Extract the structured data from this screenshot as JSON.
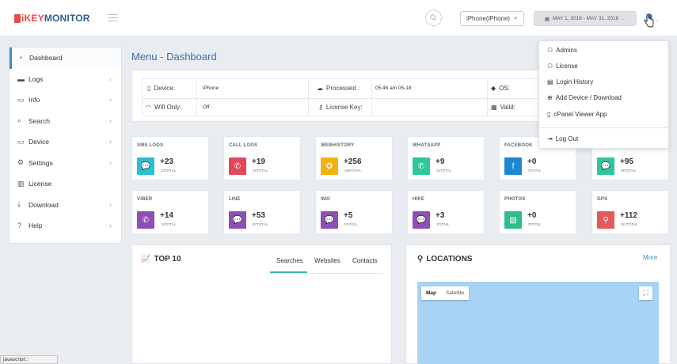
{
  "app": {
    "logo_prefix": "i",
    "logo_key": "KEY",
    "logo_rest": "MONITOR"
  },
  "header": {
    "device": "iPhone(iPhone)",
    "date_range": "MAY 1, 2018 - MAY 31, 2018"
  },
  "sidebar": {
    "items": [
      {
        "label": "Dashboard",
        "icon": "dashboard-icon"
      },
      {
        "label": "Logs",
        "icon": "folder-icon"
      },
      {
        "label": "Info",
        "icon": "folder-open-icon"
      },
      {
        "label": "Search",
        "icon": "search-icon"
      },
      {
        "label": "Device",
        "icon": "monitor-icon"
      },
      {
        "label": "Settings",
        "icon": "gear-icon"
      },
      {
        "label": "License",
        "icon": "barcode-icon"
      },
      {
        "label": "Download",
        "icon": "download-icon"
      },
      {
        "label": "Help",
        "icon": "question-icon"
      }
    ]
  },
  "page": {
    "title": "Menu - Dashboard"
  },
  "info": {
    "device_label": "Device:",
    "device_value": "iPhone",
    "processed_label": "Processed :",
    "processed_value": "05:46 am 05-18",
    "os_label": "OS:",
    "wifi_label": "Wifi Only:",
    "wifi_value": "Off",
    "license_label": "License Key:",
    "valid_label": "Valid:"
  },
  "stats": [
    {
      "label": "SMS LOGS",
      "value": "+23",
      "total": "23TOTAL",
      "color": "#2bbfd3"
    },
    {
      "label": "CALL LOGS",
      "value": "+19",
      "total": "19TOTAL",
      "color": "#e2475a"
    },
    {
      "label": "WEBHISTORY",
      "value": "+256",
      "total": "256TOTAL",
      "color": "#f0b312"
    },
    {
      "label": "WHATSAPP",
      "value": "+9",
      "total": "32TOTAL",
      "color": "#2ec69a"
    },
    {
      "label": "FACEBOOK",
      "value": "+0",
      "total": "0TOTAL",
      "color": "#1e88d0"
    },
    {
      "label": "",
      "value": "+95",
      "total": "95TOTAL",
      "color": "#2ec69a"
    },
    {
      "label": "VIBER",
      "value": "+14",
      "total": "14TOTAL",
      "color": "#8e4fb5"
    },
    {
      "label": "LINE",
      "value": "+53",
      "total": "57TOTAL",
      "color": "#8e4fb5"
    },
    {
      "label": "IMO",
      "value": "+5",
      "total": "5TOTAL",
      "color": "#8e4fb5"
    },
    {
      "label": "HIKE",
      "value": "+3",
      "total": "3TOTAL",
      "color": "#8e4fb5"
    },
    {
      "label": "PHOTOS",
      "value": "+0",
      "total": "0TOTAL",
      "color": "#2ebd8a"
    },
    {
      "label": "GPS",
      "value": "+112",
      "total": "112TOTAL",
      "color": "#e25b5b"
    }
  ],
  "top10": {
    "title": "TOP 10",
    "tabs": [
      "Searches",
      "Websites",
      "Contacts"
    ]
  },
  "locations": {
    "title": "LOCATIONS",
    "more": "More",
    "map_label": "Map",
    "satellite_label": "Satellite"
  },
  "dropdown": {
    "items": [
      "Admins",
      "License",
      "Login History",
      "Add Device / Download",
      "cPanel Viewer App",
      "Log Out"
    ]
  },
  "statusbar": {
    "text": "javascript:;"
  }
}
